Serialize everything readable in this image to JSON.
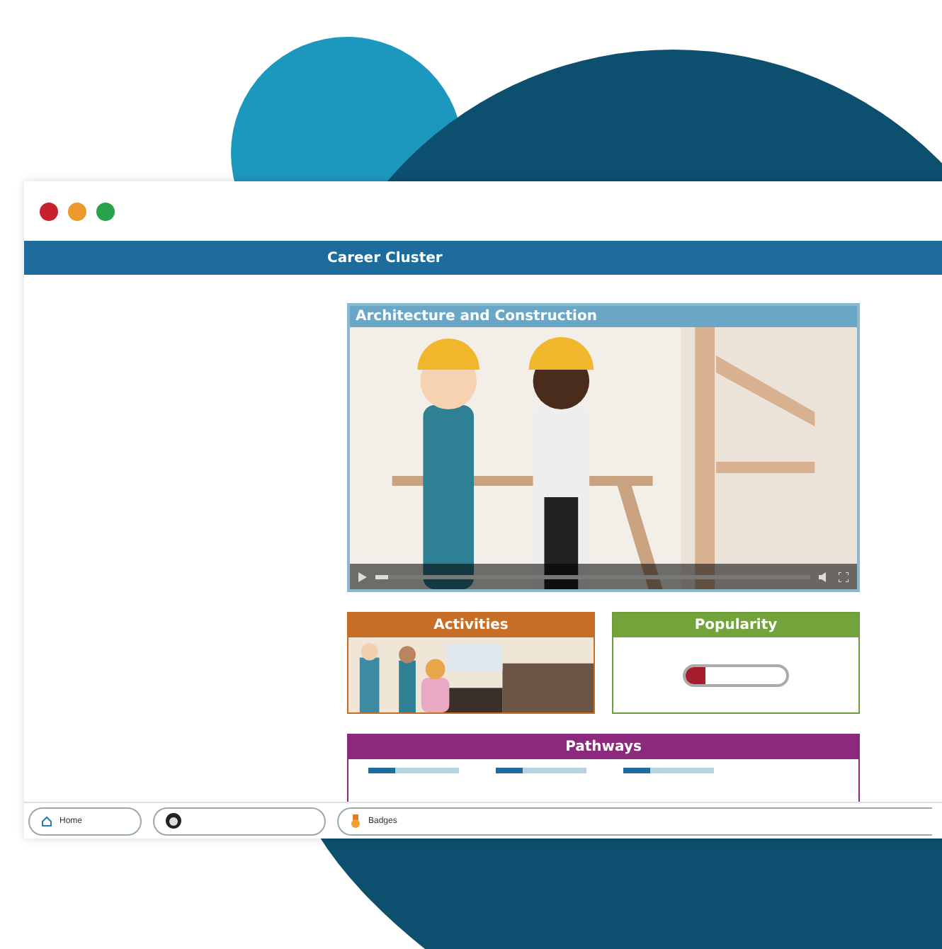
{
  "header": {
    "title": "Career Cluster"
  },
  "video": {
    "title": "Architecture and Construction",
    "progress": {
      "level": 0.03
    }
  },
  "activities": {
    "title": "Activities"
  },
  "popularity": {
    "title": "Popularity",
    "level": 0.2
  },
  "pathways": {
    "title": "Pathways",
    "items": [
      {
        "level": 0.3
      },
      {
        "level": 0.3
      },
      {
        "level": 0.3
      }
    ]
  },
  "bottom_bar": {
    "items": [
      {
        "kind": "home",
        "label": "Home"
      },
      {
        "kind": "profile"
      },
      {
        "kind": "badges",
        "label": "Badges"
      }
    ]
  }
}
